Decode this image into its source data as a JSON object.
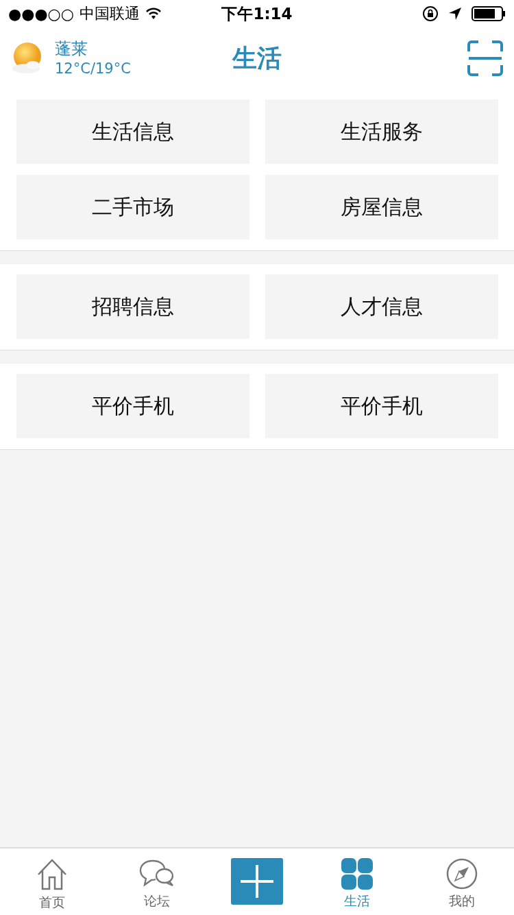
{
  "status_bar": {
    "signal": "●●●○○",
    "carrier": "中国联通",
    "time": "下午1:14"
  },
  "header": {
    "city": "蓬莱",
    "temperature": "12°C/19°C",
    "title": "生活"
  },
  "sections": [
    {
      "items": [
        "生活信息",
        "生活服务",
        "二手市场",
        "房屋信息"
      ]
    },
    {
      "items": [
        "招聘信息",
        "人才信息"
      ]
    },
    {
      "items": [
        "平价手机",
        "平价手机"
      ]
    }
  ],
  "tabs": [
    {
      "kind": "home",
      "label": "首页",
      "selected": false
    },
    {
      "kind": "forum",
      "label": "论坛",
      "selected": false
    },
    {
      "kind": "add",
      "selected": false
    },
    {
      "kind": "life",
      "label": "生活",
      "selected": true
    },
    {
      "kind": "mine",
      "label": "我的",
      "selected": false
    }
  ]
}
